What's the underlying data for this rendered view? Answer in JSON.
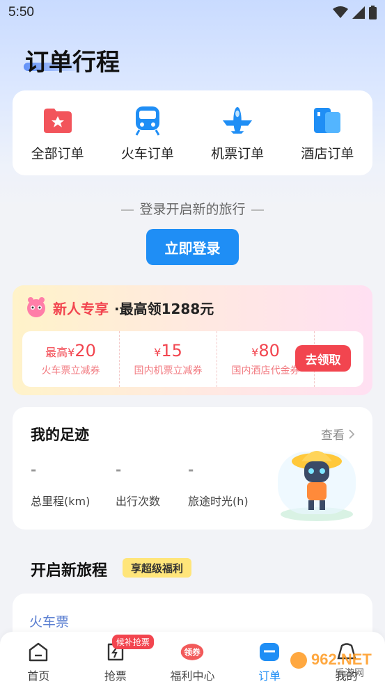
{
  "status_bar": {
    "time": "5:50"
  },
  "header": {
    "title": "订单行程"
  },
  "order_types": [
    {
      "label": "全部订单",
      "icon": "all-orders-icon"
    },
    {
      "label": "火车订单",
      "icon": "train-icon"
    },
    {
      "label": "机票订单",
      "icon": "plane-icon"
    },
    {
      "label": "酒店订单",
      "icon": "hotel-icon"
    }
  ],
  "login": {
    "hint": "登录开启新的旅行",
    "button_label": "立即登录"
  },
  "promo": {
    "title": "新人专享",
    "subtitle": "·最高领1288元",
    "coupons": [
      {
        "prefix": "最高",
        "currency": "¥",
        "amount": "20",
        "desc": "火车票立减券"
      },
      {
        "prefix": "",
        "currency": "¥",
        "amount": "15",
        "desc": "国内机票立减券"
      },
      {
        "prefix": "",
        "currency": "¥",
        "amount": "80",
        "desc": "国内酒店代金券"
      }
    ],
    "claim_label": "去领取"
  },
  "footprint": {
    "title": "我的足迹",
    "view_label": "查看",
    "stats": [
      {
        "value": "-",
        "label": "总里程(km)"
      },
      {
        "value": "-",
        "label": "出行次数"
      },
      {
        "value": "-",
        "label": "旅途时光(h)"
      }
    ]
  },
  "new_journey": {
    "title": "开启新旅程",
    "tag": "享超级福利"
  },
  "train_section": {
    "label": "火车票"
  },
  "tabbar": {
    "tabs": [
      {
        "label": "首页",
        "icon": "home-icon",
        "active": false
      },
      {
        "label": "抢票",
        "icon": "grab-ticket-icon",
        "active": false,
        "badge": "候补抢票"
      },
      {
        "label": "福利中心",
        "icon": "coupon-icon",
        "active": false,
        "icon_text": "领券"
      },
      {
        "label": "订单",
        "icon": "order-icon",
        "active": true
      },
      {
        "label": "我的",
        "icon": "profile-icon",
        "active": false
      }
    ]
  },
  "watermark": {
    "text": "962.NET",
    "sub": "乐游网"
  },
  "colors": {
    "primary": "#1f8ef5",
    "promo_red": "#f2454f",
    "tag_yellow": "#ffe57a"
  }
}
